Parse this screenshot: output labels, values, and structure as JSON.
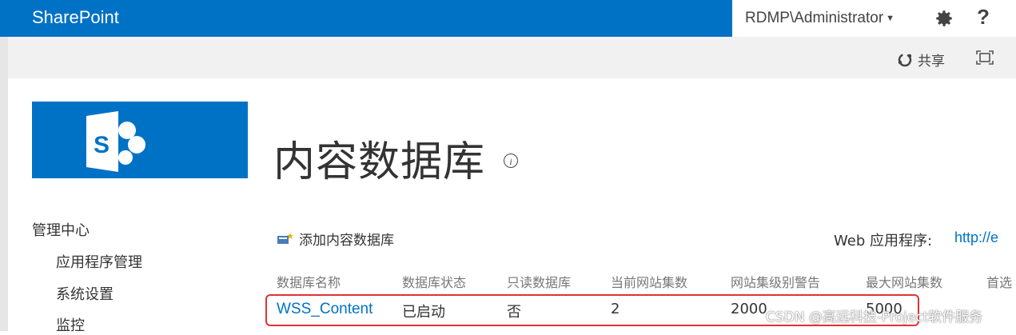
{
  "suite_bar": {
    "brand": "SharePoint",
    "user": "RDMP\\Administrator",
    "help": "?"
  },
  "ribbon": {
    "share_label": "共享"
  },
  "logo": {
    "letter": "S"
  },
  "page": {
    "title": "内容数据库",
    "info": "i"
  },
  "quick_launch": {
    "heading": "管理中心",
    "items": [
      "应用程序管理",
      "系统设置",
      "监控"
    ]
  },
  "toolbar": {
    "add_label": "添加内容数据库",
    "webapp_label": "Web 应用程序:",
    "webapp_value": "http://e"
  },
  "table": {
    "columns": [
      "数据库名称",
      "数据库状态",
      "只读数据库",
      "当前网站集数",
      "网站集级别警告",
      "最大网站集数",
      "首选"
    ],
    "rows": [
      [
        "WSS_Content",
        "已启动",
        "否",
        "2",
        "2000",
        "5000"
      ]
    ]
  },
  "watermark": "CSDN @高远科技-Project软件服务",
  "colors": {
    "brand_blue": "#0072c6",
    "highlight_red": "#e23232"
  }
}
